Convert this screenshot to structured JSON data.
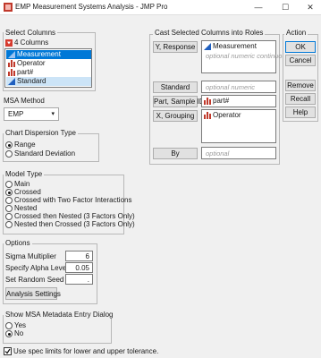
{
  "window": {
    "title": "EMP Measurement Systems Analysis - JMP Pro",
    "minimize": "—",
    "maximize": "☐",
    "close": "✕"
  },
  "select_columns": {
    "label": "Select Columns",
    "count": "4 Columns",
    "items": [
      "Measurement",
      "Operator",
      "part#",
      "Standard"
    ]
  },
  "cast": {
    "label": "Cast Selected Columns into Roles",
    "y_button": "Y, Response",
    "y_values": [
      "Measurement"
    ],
    "y_placeholder": "optional numeric continuous",
    "standard_button": "Standard",
    "standard_placeholder": "optional numeric",
    "part_button": "Part, Sample ID",
    "part_value": "part#",
    "x_button": "X, Grouping",
    "x_value": "Operator",
    "by_button": "By",
    "by_placeholder": "optional"
  },
  "action": {
    "label": "Action",
    "ok": "OK",
    "cancel": "Cancel",
    "remove": "Remove",
    "recall": "Recall",
    "help": "Help"
  },
  "msa_method": {
    "label": "MSA Method",
    "selected": "EMP"
  },
  "dispersion": {
    "label": "Chart Dispersion Type",
    "options": [
      "Range",
      "Standard Deviation"
    ],
    "selected_index": 0
  },
  "model_type": {
    "label": "Model Type",
    "options": [
      "Main",
      "Crossed",
      "Crossed with Two Factor Interactions",
      "Nested",
      "Crossed then Nested (3 Factors Only)",
      "Nested then Crossed (3 Factors Only)"
    ],
    "selected_index": 1
  },
  "options": {
    "label": "Options",
    "sigma_label": "Sigma Multiplier",
    "sigma_value": "6",
    "alpha_label": "Specify Alpha Level",
    "alpha_value": "0.05",
    "seed_label": "Set Random Seed",
    "seed_value": ".",
    "analysis_button": "Analysis Settings"
  },
  "metadata_dialog": {
    "label": "Show MSA Metadata Entry Dialog",
    "options": [
      "Yes",
      "No"
    ],
    "selected_index": 1
  },
  "spec_limits": {
    "label": "Use spec limits for lower and upper tolerance.",
    "checked": true
  },
  "colors": {
    "selection": "#0078d7",
    "selection_light": "#cce4f7",
    "continuous_icon": "#1f5fbf",
    "nominal_icon": "#c0392b"
  }
}
